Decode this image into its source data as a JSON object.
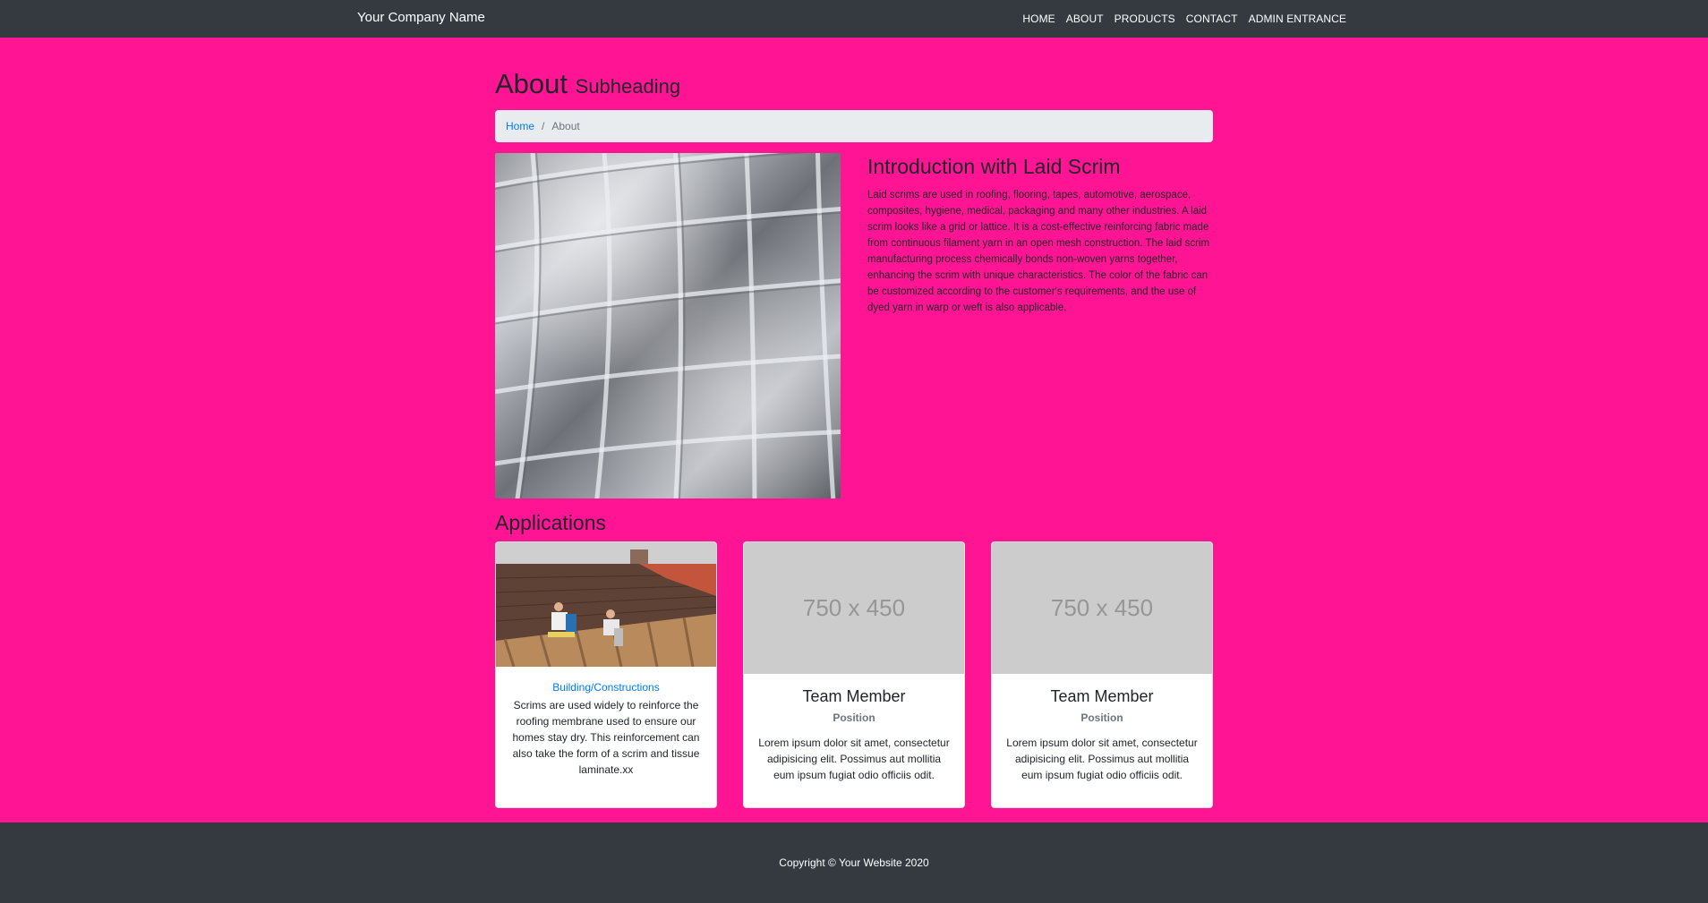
{
  "navbar": {
    "brand": "Your Company Name",
    "links": [
      "HOME",
      "ABOUT",
      "PRODUCTS",
      "CONTACT",
      "ADMIN ENTRANCE"
    ]
  },
  "header": {
    "title": "About",
    "subtitle": "Subheading"
  },
  "breadcrumb": {
    "home": "Home",
    "separator": "/",
    "current": "About"
  },
  "intro": {
    "heading": "Introduction with Laid Scrim",
    "body": "Laid scrims are used in roofing, flooring, tapes, automotive, aerospace, composites, hygiene, medical, packaging and many other industries. A laid scrim looks like a grid or lattice. It is a cost-effective reinforcing fabric made from continuous filament yarn in an open mesh construction. The laid scrim manufacturing process chemically bonds non-woven yarns together, enhancing the scrim with unique characteristics. The color of the fabric can be customized according to the customer's requirements, and the use of dyed yarn in warp or weft is also applicable."
  },
  "applications": {
    "heading": "Applications",
    "cards": [
      {
        "link": "Building/Constructions",
        "text": "Scrims are used widely to reinforce the roofing membrane used to ensure our homes stay dry. This reinforcement can also take the form of a scrim and tissue laminate.xx"
      },
      {
        "placeholder": "750 x 450",
        "title": "Team Member",
        "subtitle": "Position",
        "text": "Lorem ipsum dolor sit amet, consectetur adipisicing elit. Possimus aut mollitia eum ipsum fugiat odio officiis odit."
      },
      {
        "placeholder": "750 x 450",
        "title": "Team Member",
        "subtitle": "Position",
        "text": "Lorem ipsum dolor sit amet, consectetur adipisicing elit. Possimus aut mollitia eum ipsum fugiat odio officiis odit."
      }
    ]
  },
  "footer": {
    "copyright": "Copyright © Your Website 2020"
  },
  "colors": {
    "page_background": "#ff1493",
    "navbar": "#343a40",
    "link": "#007bff"
  }
}
